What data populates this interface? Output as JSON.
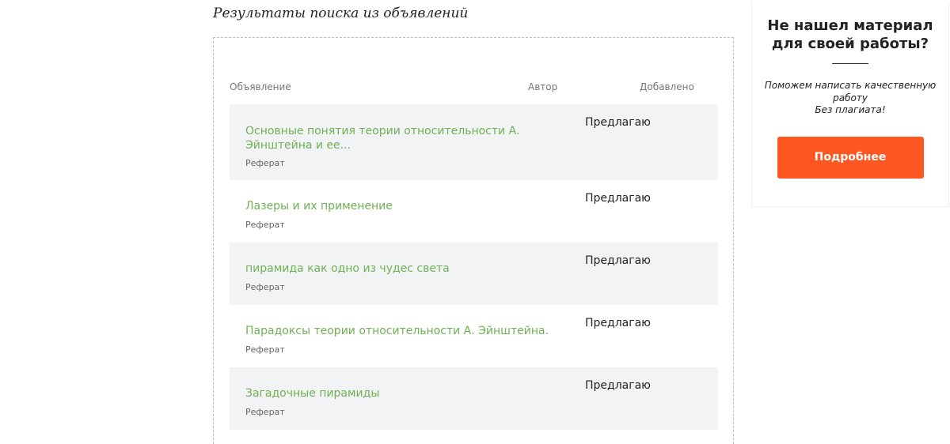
{
  "results": {
    "heading": "Результаты поиска из объявлений",
    "columns": {
      "ad": "Объявление",
      "author": "Автор",
      "added": "Добавлено"
    },
    "rows": [
      {
        "title": "Основные понятия теории относительности А. Эйнштейна и ее...",
        "type": "Реферат",
        "author": "Предлагаю"
      },
      {
        "title": "Лазеры и их применение",
        "type": "Реферат",
        "author": "Предлагаю"
      },
      {
        "title": "пирамида как одно из чудес света",
        "type": "Реферат",
        "author": "Предлагаю"
      },
      {
        "title": "Парадоксы теории относительности А. Эйнштейна.",
        "type": "Реферат",
        "author": "Предлагаю"
      },
      {
        "title": "Загадочные пирамиды",
        "type": "Реферат",
        "author": "Предлагаю"
      }
    ]
  },
  "sidebar": {
    "title": "Не нашел материал для своей работы?",
    "text_line1": "Поможем написать качественную работу",
    "text_line2": "Без плагиата!",
    "button_label": "Подробнее",
    "button_color": "#ff5722"
  },
  "colors": {
    "link_green": "#6fb153",
    "row_shade": "#f2f3f4"
  }
}
